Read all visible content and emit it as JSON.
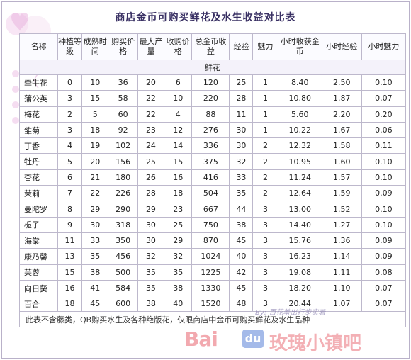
{
  "title": "商店金币可购买鲜花及水生收益对比表",
  "headers": [
    "名称",
    "种植等级",
    "成熟时间",
    "购买价格",
    "最大产量",
    "收购价格",
    "总金币收益",
    "经验",
    "魅力",
    "小时收获金币",
    "小时经验",
    "小时魅力"
  ],
  "section_label": "鲜花",
  "rows": [
    [
      "牵牛花",
      "0",
      "10",
      "36",
      "20",
      "6",
      "120",
      "25",
      "1",
      "8.40",
      "2.50",
      "0.10"
    ],
    [
      "蒲公英",
      "3",
      "15",
      "58",
      "22",
      "10",
      "220",
      "28",
      "1",
      "10.80",
      "1.87",
      "0.07"
    ],
    [
      "梅花",
      "2",
      "5",
      "60",
      "22",
      "4",
      "88",
      "11",
      "1",
      "5.60",
      "2.20",
      "0.20"
    ],
    [
      "雏菊",
      "3",
      "18",
      "92",
      "23",
      "12",
      "276",
      "30",
      "1",
      "10.22",
      "1.67",
      "0.06"
    ],
    [
      "丁香",
      "4",
      "19",
      "102",
      "24",
      "14",
      "336",
      "30",
      "2",
      "12.32",
      "1.58",
      "0.11"
    ],
    [
      "牡丹",
      "5",
      "20",
      "156",
      "25",
      "15",
      "375",
      "32",
      "2",
      "10.95",
      "1.60",
      "0.10"
    ],
    [
      "杏花",
      "6",
      "21",
      "180",
      "26",
      "16",
      "416",
      "33",
      "2",
      "11.24",
      "1.57",
      "0.10"
    ],
    [
      "茉莉",
      "7",
      "22",
      "226",
      "28",
      "18",
      "504",
      "35",
      "2",
      "12.64",
      "1.59",
      "0.09"
    ],
    [
      "曼陀罗",
      "8",
      "29",
      "290",
      "29",
      "23",
      "667",
      "44",
      "3",
      "13.00",
      "1.52",
      "0.10"
    ],
    [
      "栀子",
      "9",
      "30",
      "318",
      "30",
      "25",
      "750",
      "38",
      "3",
      "14.40",
      "1.27",
      "0.10"
    ],
    [
      "海棠",
      "11",
      "33",
      "350",
      "30",
      "29",
      "870",
      "45",
      "3",
      "15.76",
      "1.36",
      "0.09"
    ],
    [
      "康乃馨",
      "13",
      "35",
      "456",
      "32",
      "32",
      "1024",
      "40",
      "3",
      "16.23",
      "1.14",
      "0.09"
    ],
    [
      "芙蓉",
      "15",
      "38",
      "500",
      "35",
      "35",
      "1225",
      "42",
      "3",
      "19.08",
      "1.11",
      "0.08"
    ],
    [
      "向日葵",
      "16",
      "41",
      "584",
      "35",
      "38",
      "1330",
      "45",
      "3",
      "18.20",
      "1.10",
      "0.07"
    ],
    [
      "百合",
      "18",
      "45",
      "600",
      "38",
      "40",
      "1520",
      "48",
      "3",
      "20.44",
      "1.07",
      "0.07"
    ]
  ],
  "footer": "此表不含藤类，QB购买水生及各种绝版花，仅限商店中金币可购买鲜花及水生品种",
  "watermark": {
    "baidu": "Bai",
    "du": "du",
    "tieba": "玫瑰小镇吧",
    "small": "By: 百花羞出行步实着"
  },
  "colors": {
    "title": "#3a3164",
    "grid": "#bdb8cc",
    "watermark_red": "#e8646e",
    "watermark_blue": "#5b83d8"
  }
}
